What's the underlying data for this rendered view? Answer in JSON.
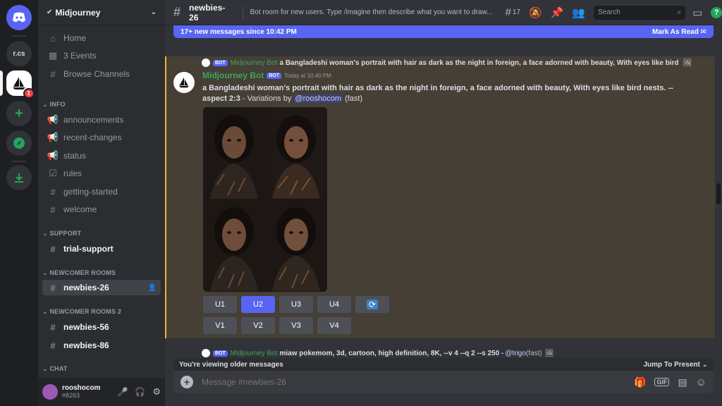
{
  "server": {
    "name": "Midjourney",
    "rail_items": [
      {
        "label": "r.cs"
      },
      {
        "label": "",
        "badge": "1"
      }
    ]
  },
  "sidebar": {
    "top_items": [
      {
        "label": "Home",
        "icon": "home-icon"
      },
      {
        "label": "3 Events",
        "icon": "calendar-icon"
      },
      {
        "label": "Browse Channels",
        "icon": "browse-channels-icon"
      }
    ],
    "categories": {
      "info": "INFO",
      "support": "SUPPORT",
      "newcomer": "NEWCOMER ROOMS",
      "newcomer2": "NEWCOMER ROOMS 2",
      "chat": "CHAT"
    },
    "info_channels": [
      {
        "label": "announcements",
        "icon": "announcement-icon"
      },
      {
        "label": "recent-changes",
        "icon": "announcement-icon"
      },
      {
        "label": "status",
        "icon": "announcement-icon"
      },
      {
        "label": "rules",
        "icon": "rules-icon"
      },
      {
        "label": "getting-started",
        "icon": "hash-icon"
      },
      {
        "label": "welcome",
        "icon": "hash-icon"
      }
    ],
    "support_channels": [
      {
        "label": "trial-support"
      }
    ],
    "newcomer_channels": [
      {
        "label": "newbies-26"
      }
    ],
    "newcomer2_channels": [
      {
        "label": "newbies-56"
      },
      {
        "label": "newbies-86"
      }
    ]
  },
  "user": {
    "name": "rooshocom",
    "tag": "#8263"
  },
  "topbar": {
    "channel": "newbies-26",
    "topic": "Bot room for new users. Type /imagine then describe what you want to draw...",
    "thread_count": "17",
    "search_placeholder": "Search"
  },
  "banner": {
    "text": "17+ new messages since 10:42 PM",
    "action": "Mark As Read"
  },
  "message": {
    "reply_author": "Midjourney Bot",
    "reply_text": "a Bangladeshi woman's portrait with hair as dark as the night in foreign, a face adorned with beauty, With eyes like bird",
    "bot_tag": "BOT",
    "author": "Midjourney Bot",
    "timestamp": "Today at 10:40 PM",
    "prompt_bold": "a Bangladeshi woman's portrait with hair as dark as the night in foreign, a face adorned with beauty, With eyes like bird nests. --aspect 2:3",
    "prompt_suffix": " - Variations by ",
    "mention": "@rooshocom",
    "speed": " (fast)",
    "upscale_buttons": [
      "U1",
      "U2",
      "U3",
      "U4"
    ],
    "variation_buttons": [
      "V1",
      "V2",
      "V3",
      "V4"
    ]
  },
  "next_message": {
    "reply_author": "Midjourney Bot",
    "reply_text": "miaw pokemom, 3d, cartoon, high definition, 8K, --v 4 --q 2 --s 250 - ",
    "mention": "@trigo",
    "speed": " (fast)"
  },
  "older_bar": {
    "text": "You're viewing older messages",
    "action": "Jump To Present"
  },
  "composer": {
    "placeholder": "Message #newbies-26"
  },
  "colors": {
    "accent": "#5865f2",
    "highlight": "#f0b232",
    "bot_green": "#3ba55c"
  }
}
